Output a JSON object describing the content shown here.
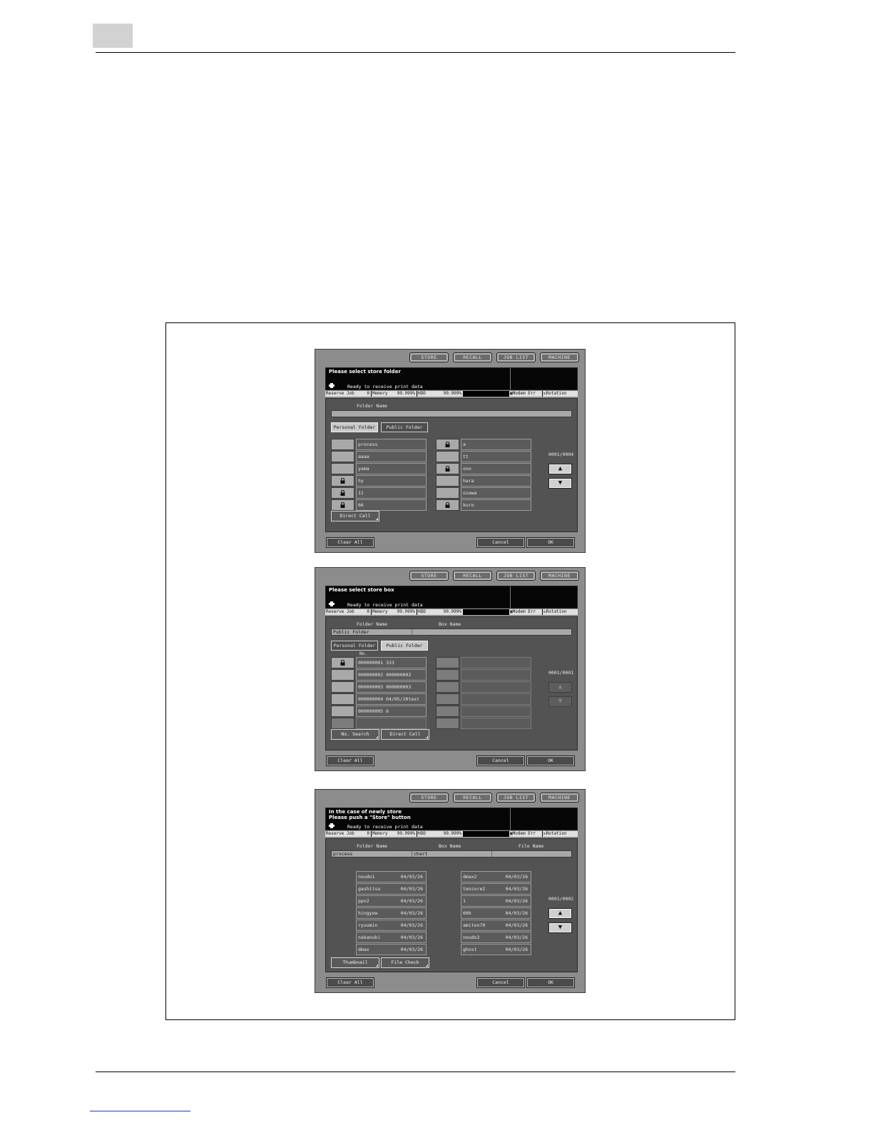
{
  "panels": [
    {
      "tabs": [
        "STORE",
        "RECALL",
        "JOB LIST",
        "MACHINE"
      ],
      "message": "Please select store folder",
      "status_text": "Ready to receive print data",
      "statusbar": {
        "reserve_label": "Reserve Job",
        "reserve_value": "0",
        "memory_label": "Memory",
        "memory_value": "99.999%",
        "hdd_label": "HDD",
        "hdd_value": "99.999%",
        "modem": "Modem Err",
        "rotation": "Rotation"
      },
      "folder_name_label": "Folder Name",
      "folder_tabs": [
        "Personal Folder",
        "Public Folder"
      ],
      "active_folder_tab": "Personal Folder",
      "left_items": [
        {
          "name": "process",
          "locked": false
        },
        {
          "name": "aaaa",
          "locked": false
        },
        {
          "name": "yama",
          "locked": false
        },
        {
          "name": "hy",
          "locked": true
        },
        {
          "name": "11",
          "locked": true
        },
        {
          "name": "66",
          "locked": true
        }
      ],
      "right_items": [
        {
          "name": "a",
          "locked": true
        },
        {
          "name": "tt",
          "locked": false
        },
        {
          "name": "ono",
          "locked": true
        },
        {
          "name": "hara",
          "locked": false
        },
        {
          "name": "ozawa",
          "locked": false
        },
        {
          "name": "kuro",
          "locked": true
        }
      ],
      "page_indicator": "0001/0004",
      "arrows_enabled": true,
      "direct_call_label": "Direct Call",
      "clear_all_label": "Clear All",
      "cancel_label": "Cancel",
      "ok_label": "OK"
    },
    {
      "tabs": [
        "STORE",
        "RECALL",
        "JOB LIST",
        "MACHINE"
      ],
      "message": "Please select store box",
      "status_text": "Ready to receive print data",
      "statusbar": {
        "reserve_label": "Reserve Job",
        "reserve_value": "0",
        "memory_label": "Memory",
        "memory_value": "99.999%",
        "hdd_label": "HDD",
        "hdd_value": "99.999%",
        "modem": "Modem Err",
        "rotation": "Rotation"
      },
      "folder_name_label": "Folder Name",
      "box_name_label": "Box Name",
      "folder_name_value": "Public Folder",
      "box_name_value": "",
      "folder_tabs": [
        "Personal Folder",
        "Public Folder"
      ],
      "active_folder_tab": "Public Folder",
      "no_label": "No.",
      "left_items": [
        {
          "name": "000000001 333",
          "locked": true
        },
        {
          "name": "000000002 000000002",
          "locked": false
        },
        {
          "name": "000000003 000000003",
          "locked": false
        },
        {
          "name": "000000004 04/05/20test",
          "locked": false
        },
        {
          "name": "000000005 6",
          "locked": false
        },
        {
          "name": "",
          "locked": false
        }
      ],
      "right_items": [
        {
          "name": "",
          "locked": false
        },
        {
          "name": "",
          "locked": false
        },
        {
          "name": "",
          "locked": false
        },
        {
          "name": "",
          "locked": false
        },
        {
          "name": "",
          "locked": false
        },
        {
          "name": "",
          "locked": false
        }
      ],
      "page_indicator": "0001/0001",
      "arrows_enabled": false,
      "no_search_label": "No. Search",
      "direct_call_label": "Direct Call",
      "clear_all_label": "Clear All",
      "cancel_label": "Cancel",
      "ok_label": "OK"
    },
    {
      "tabs": [
        "STORE",
        "RECALL",
        "JOB LIST",
        "MACHINE"
      ],
      "message": "In the case of newly store\nPlease push a \"Store\" button",
      "status_text": "Ready to receive print data",
      "statusbar": {
        "reserve_label": "Reserve Job",
        "reserve_value": "0",
        "memory_label": "Memory",
        "memory_value": "99.999%",
        "hdd_label": "HDD",
        "hdd_value": "99.999%",
        "modem": "Modem Err",
        "rotation": "Rotation"
      },
      "folder_name_label": "Folder Name",
      "box_name_label": "Box Name",
      "file_name_label": "File Name",
      "folder_name_value": "process",
      "box_name_value": "chart",
      "file_name_value": "",
      "left_files": [
        {
          "name": "noudo1",
          "date": "04/03/26"
        },
        {
          "name": "gashitsu",
          "date": "04/03/26"
        },
        {
          "name": "ppn2",
          "date": "04/03/26"
        },
        {
          "name": "hingyow",
          "date": "04/03/26"
        },
        {
          "name": "ryuumin",
          "date": "04/03/26"
        },
        {
          "name": "nakanuki",
          "date": "04/03/26"
        },
        {
          "name": "dmax",
          "date": "04/03/26"
        }
      ],
      "right_files": [
        {
          "name": "dmax2",
          "date": "04/03/26"
        },
        {
          "name": "tenzure2",
          "date": "04/03/26"
        },
        {
          "name": "1",
          "date": "04/03/26"
        },
        {
          "name": "60k",
          "date": "04/03/26"
        },
        {
          "name": "amiten70",
          "date": "04/03/26"
        },
        {
          "name": "noudo2",
          "date": "04/03/26"
        },
        {
          "name": "ghost",
          "date": "04/03/26"
        }
      ],
      "page_indicator": "0001/0002",
      "arrows_enabled": true,
      "thumbnail_label": "Thumbnail",
      "file_check_label": "File Check",
      "clear_all_label": "Clear All",
      "cancel_label": "Cancel",
      "ok_label": "OK"
    }
  ]
}
